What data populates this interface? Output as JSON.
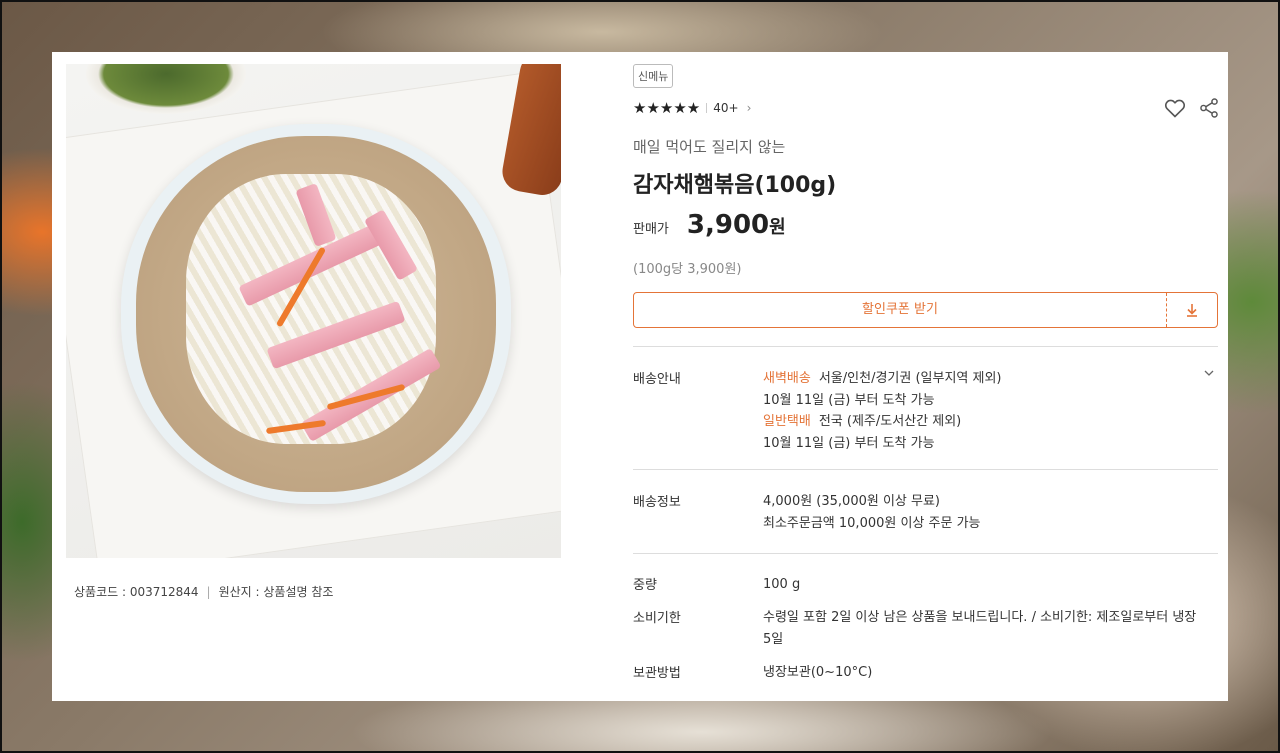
{
  "product": {
    "code_label": "상품코드 : 003712844",
    "origin_label": "원산지 : 상품설명 참조",
    "badge": "신메뉴",
    "stars": "★★★★★",
    "review_count": "40+",
    "subtitle": "매일 먹어도 질리지 않는",
    "title": "감자채햄볶음(100g)",
    "price_label": "판매가",
    "price": "3,900",
    "price_unit": "원",
    "unit_price": "(100g당 3,900원)"
  },
  "coupon": {
    "label": "할인쿠폰 받기"
  },
  "delivery": {
    "key": "배송안내",
    "dawn_tag": "새벽배송",
    "dawn_region": "서울/인천/경기권 (일부지역 제외)",
    "dawn_date": "10월 11일 (금) 부터 도착 가능",
    "normal_tag": "일반택배",
    "normal_region": "전국 (제주/도서산간 제외)",
    "normal_date": "10월 11일 (금) 부터 도착 가능"
  },
  "shipping": {
    "key": "배송정보",
    "fee": "4,000원 (35,000원 이상 무료)",
    "minimum": "최소주문금액 10,000원 이상 주문 가능"
  },
  "specs": {
    "weight_key": "중량",
    "weight_value": "100 g",
    "expiry_key": "소비기한",
    "expiry_value": "수령일 포함 2일 이상 남은 상품을 보내드립니다. / 소비기한: 제조일로부터 냉장 5일",
    "storage_key": "보관방법",
    "storage_value": "냉장보관(0~10°C)"
  },
  "colors": {
    "accent": "#e47438"
  },
  "icons": [
    "heart-icon",
    "share-icon",
    "download-icon",
    "chevron-right-icon",
    "chevron-down-icon"
  ]
}
